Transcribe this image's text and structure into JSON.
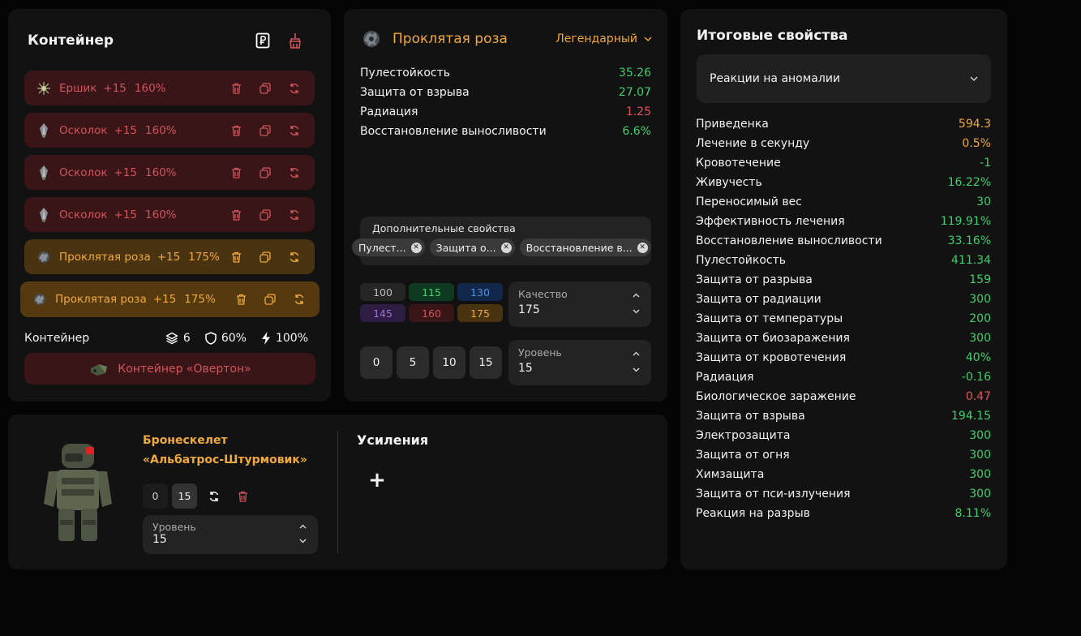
{
  "container": {
    "title": "Контейнер",
    "artifacts": [
      {
        "name": "Ершик",
        "plus": "+15",
        "percent": "160%",
        "style": "red",
        "icon": "spiky-artifact-icon"
      },
      {
        "name": "Осколок",
        "plus": "+15",
        "percent": "160%",
        "style": "red",
        "icon": "shard-artifact-icon"
      },
      {
        "name": "Осколок",
        "plus": "+15",
        "percent": "160%",
        "style": "red",
        "icon": "shard-artifact-icon"
      },
      {
        "name": "Осколок",
        "plus": "+15",
        "percent": "160%",
        "style": "red",
        "icon": "shard-artifact-icon"
      },
      {
        "name": "Проклятая роза",
        "plus": "+15",
        "percent": "175%",
        "style": "gold",
        "icon": "rose-artifact-icon"
      },
      {
        "name": "Проклятая роза",
        "plus": "+15",
        "percent": "175%",
        "style": "gold-active",
        "icon": "rose-artifact-icon"
      }
    ],
    "stats_label": "Контейнер",
    "slots": "6",
    "protection": "60%",
    "efficiency": "100%",
    "container_name": "Контейнер «Овертон»"
  },
  "artifact": {
    "name": "Проклятая роза",
    "rarity": "Легендарный",
    "stats": [
      {
        "label": "Пулестойкость",
        "value": "35.26",
        "color": "green"
      },
      {
        "label": "Защита от взрыва",
        "value": "27.07",
        "color": "green"
      },
      {
        "label": "Радиация",
        "value": "1.25",
        "color": "red"
      },
      {
        "label": "Восстановление выносливости",
        "value": "6.6%",
        "color": "green"
      }
    ],
    "extra_label": "Дополнительные свойства",
    "extra_chips": [
      "Пулест...",
      "Защита о...",
      "Восстановление в..."
    ],
    "quality_options": [
      "100",
      "115",
      "130",
      "145",
      "160",
      "175"
    ],
    "quality_label": "Качество",
    "quality_value": "175",
    "level_options": [
      "0",
      "5",
      "10",
      "15"
    ],
    "level_label": "Уровень",
    "level_value": "15"
  },
  "totals": {
    "title": "Итоговые свойства",
    "filter": "Реакции на аномалии",
    "rows": [
      {
        "label": "Приведенка",
        "value": "594.3",
        "color": "orange"
      },
      {
        "label": "Лечение в секунду",
        "value": "0.5%",
        "color": "orange"
      },
      {
        "label": "Кровотечение",
        "value": "-1",
        "color": "green"
      },
      {
        "label": "Живучесть",
        "value": "16.22%",
        "color": "green"
      },
      {
        "label": "Переносимый вес",
        "value": "30",
        "color": "green"
      },
      {
        "label": "Эффективность лечения",
        "value": "119.91%",
        "color": "green"
      },
      {
        "label": "Восстановление выносливости",
        "value": "33.16%",
        "color": "green"
      },
      {
        "label": "Пулестойкость",
        "value": "411.34",
        "color": "green"
      },
      {
        "label": "Защита от разрыва",
        "value": "159",
        "color": "green"
      },
      {
        "label": "Защита от радиации",
        "value": "300",
        "color": "green"
      },
      {
        "label": "Защита от температуры",
        "value": "200",
        "color": "green"
      },
      {
        "label": "Защита от биозаражения",
        "value": "300",
        "color": "green"
      },
      {
        "label": "Защита от кровотечения",
        "value": "40%",
        "color": "green"
      },
      {
        "label": "Радиация",
        "value": "-0.16",
        "color": "green"
      },
      {
        "label": "Биологическое заражение",
        "value": "0.47",
        "color": "red"
      },
      {
        "label": "Защита от взрыва",
        "value": "194.15",
        "color": "green"
      },
      {
        "label": "Электрозащита",
        "value": "300",
        "color": "green"
      },
      {
        "label": "Защита от огня",
        "value": "300",
        "color": "green"
      },
      {
        "label": "Химзащита",
        "value": "300",
        "color": "green"
      },
      {
        "label": "Защита от пси-излучения",
        "value": "300",
        "color": "green"
      },
      {
        "label": "Реакция на разрыв",
        "value": "8.11%",
        "color": "green"
      }
    ]
  },
  "armor": {
    "name_line1": "Бронескелет",
    "name_line2": "«Альбатрос-Штурмовик»",
    "lvl_min": "0",
    "lvl_max": "15",
    "level_label": "Уровень",
    "level_value": "15",
    "boosts_title": "Усиления",
    "add_symbol": "+"
  },
  "colors": {
    "green": "#3fcf6e",
    "red": "#e2555a",
    "orange": "#f0a93a",
    "panel": "#121212"
  }
}
